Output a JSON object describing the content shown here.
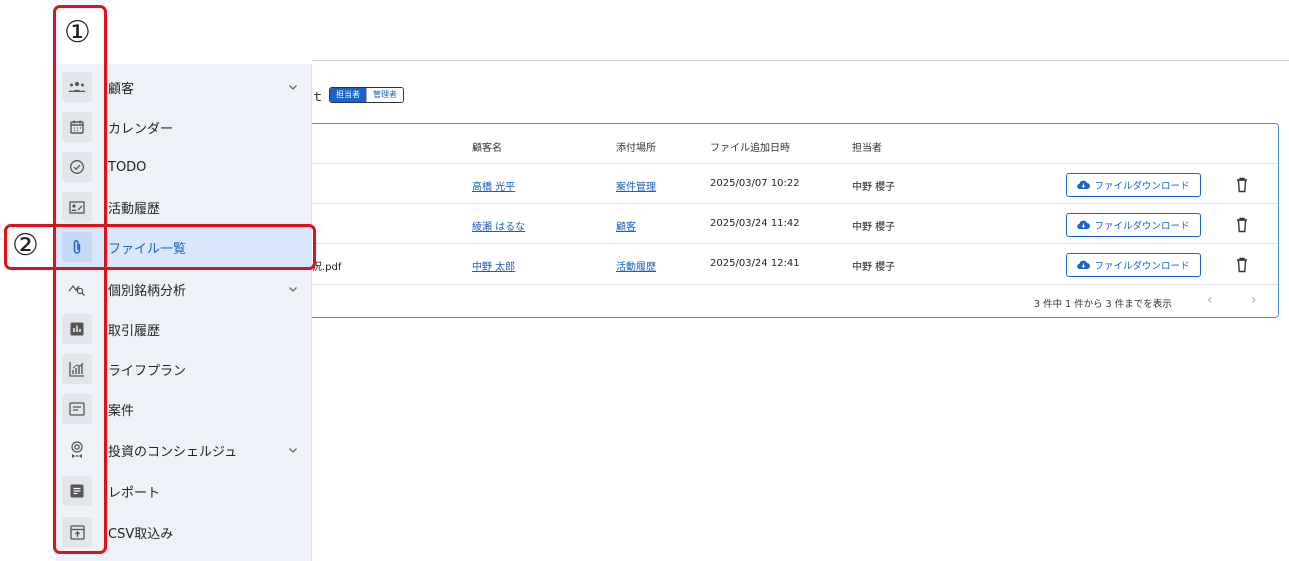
{
  "annotations": {
    "marker1": "①",
    "marker2": "②"
  },
  "header": {
    "title_fragment": "ｔ",
    "roles": [
      "担当者",
      "管理者"
    ],
    "active_role": "担当者"
  },
  "sidebar": {
    "items": [
      {
        "label": "顧客",
        "icon": "customers-icon",
        "has_submenu": true
      },
      {
        "label": "カレンダー",
        "icon": "calendar-icon",
        "has_submenu": false
      },
      {
        "label": "TODO",
        "icon": "check-circle-icon",
        "has_submenu": false
      },
      {
        "label": "活動履歴",
        "icon": "activity-card-icon",
        "has_submenu": false
      },
      {
        "label": "ファイル一覧",
        "icon": "paperclip-icon",
        "has_submenu": false,
        "active": true
      },
      {
        "label": "個別銘柄分析",
        "icon": "chart-search-icon",
        "has_submenu": true
      },
      {
        "label": "取引履歴",
        "icon": "bar-report-icon",
        "has_submenu": false
      },
      {
        "label": "ライフプラン",
        "icon": "growth-chart-icon",
        "has_submenu": false
      },
      {
        "label": "案件",
        "icon": "deal-card-icon",
        "has_submenu": false
      },
      {
        "label": "投資のコンシェルジュ",
        "icon": "concierge-icon",
        "has_submenu": true
      },
      {
        "label": "レポート",
        "icon": "document-icon",
        "has_submenu": false
      },
      {
        "label": "CSV取込み",
        "icon": "upload-box-icon",
        "has_submenu": false
      }
    ]
  },
  "table": {
    "columns": [
      "顧客名",
      "添付場所",
      "ファイル追加日時",
      "担当者"
    ],
    "rows": [
      {
        "file": "",
        "customer": "高橋 光平",
        "location": "案件管理",
        "added": "2025/03/07 10:22",
        "owner": "中野 櫻子"
      },
      {
        "file": "",
        "customer": "綾瀬 はるな",
        "location": "顧客",
        "added": "2025/03/24 11:42",
        "owner": "中野 櫻子"
      },
      {
        "file": "況.pdf",
        "customer": "中野 太郎",
        "location": "活動履歴",
        "added": "2025/03/24 12:41",
        "owner": "中野 櫻子"
      }
    ],
    "download_label": "ファイルダウンロード",
    "pagination": "3 件中 1 件から 3 件までを表示",
    "prev": "‹",
    "next": "›"
  },
  "colors": {
    "accent": "#1a63c9",
    "annotation": "#e0101a",
    "sidebar_bg": "#eef2f8",
    "active_bg": "#d9e7fa"
  }
}
